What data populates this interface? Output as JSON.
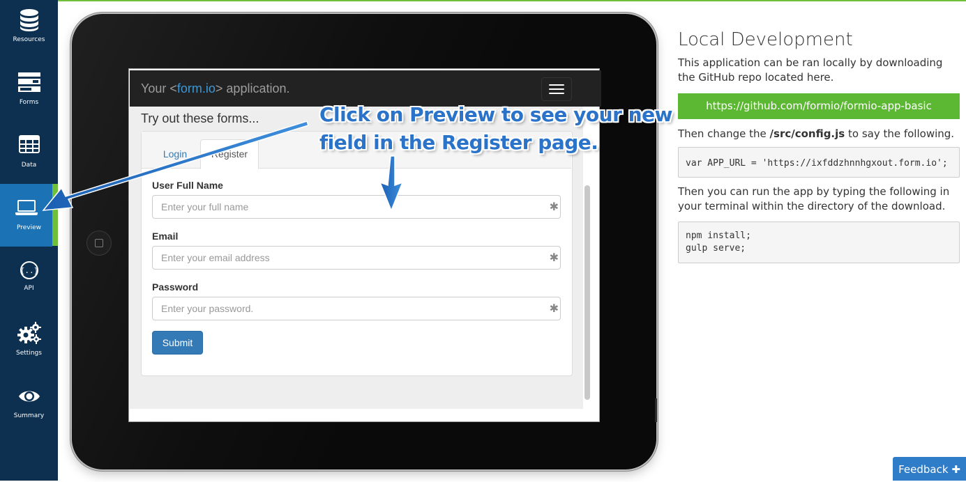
{
  "sidebar": {
    "items": [
      {
        "label": "Resources",
        "icon": "database-icon"
      },
      {
        "label": "Forms",
        "icon": "forms-icon"
      },
      {
        "label": "Data",
        "icon": "table-icon"
      },
      {
        "label": "Preview",
        "icon": "laptop-icon",
        "active": true
      },
      {
        "label": "API",
        "icon": "api-icon"
      },
      {
        "label": "Settings",
        "icon": "gears-icon"
      },
      {
        "label": "Summary",
        "icon": "eye-icon"
      }
    ]
  },
  "preview_app": {
    "brand_prefix": "Your <",
    "brand_form": "form",
    "brand_io": ".io",
    "brand_suffix": "> application.",
    "page_title": "Try out these forms...",
    "tabs": [
      {
        "label": "Login"
      },
      {
        "label": "Register",
        "active": true
      }
    ],
    "fields": [
      {
        "label": "User Full Name",
        "placeholder": "Enter your full name"
      },
      {
        "label": "Email",
        "placeholder": "Enter your email address"
      },
      {
        "label": "Password",
        "placeholder": "Enter your password."
      }
    ],
    "required_marker": "✱",
    "submit_label": "Submit"
  },
  "callout": {
    "line1": "Click on Preview to see your new",
    "line2": "field in the Register page."
  },
  "local_dev": {
    "title": "Local Development",
    "intro": "This application can be ran locally by downloading the GitHub repo located here.",
    "repo_link": "https://github.com/formio/formio-app-basic",
    "config_prefix": "Then change the ",
    "config_file": "/src/config.js",
    "config_suffix": " to say the following.",
    "config_code": "var APP_URL = 'https://ixfddzhnnhgxout.form.io';",
    "run_text": "Then you can run the app by typing the following in your terminal within the directory of the download.",
    "run_code": [
      "npm install;",
      "gulp serve;"
    ]
  },
  "feedback": {
    "label": "Feedback",
    "icon": "plus-icon"
  },
  "colors": {
    "sidebar": "#0d3050",
    "active": "#1b72b5",
    "accent_green": "#5cb833",
    "callout_blue": "#2a73c9"
  }
}
